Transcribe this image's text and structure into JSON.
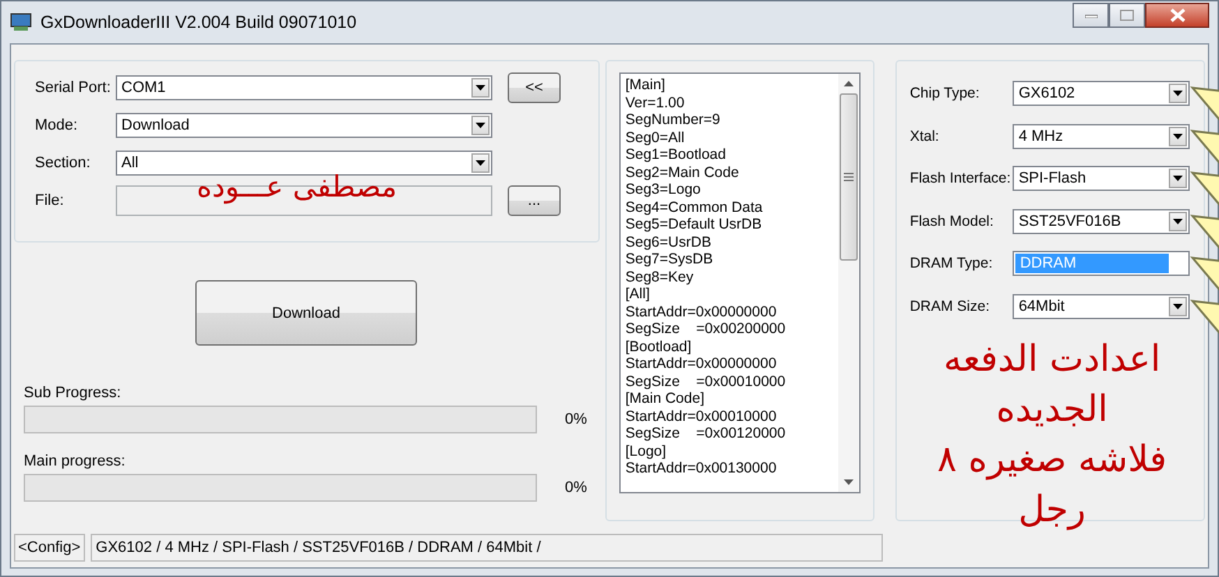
{
  "window": {
    "title": "GxDownloaderIII V2.004 Build 09071010"
  },
  "port_settings": {
    "fields": [
      {
        "kind": "combo",
        "label": "Serial Port:",
        "value": "COM1",
        "button": "<<"
      },
      {
        "kind": "combo",
        "label": "Mode:",
        "value": "Download"
      },
      {
        "kind": "combo",
        "label": "Section:",
        "value": "All"
      },
      {
        "kind": "file",
        "label": "File:",
        "disabled": true,
        "button": "..."
      }
    ]
  },
  "download_button": "Download",
  "progress": [
    {
      "label": "Sub Progress:",
      "level": 0,
      "reading": "0%"
    },
    {
      "label": "Main progress:",
      "level": 0,
      "reading": "0%"
    }
  ],
  "config_list": [
    "[Main]",
    "Ver=1.00",
    "SegNumber=9",
    "Seg0=All",
    "Seg1=Bootload",
    "Seg2=Main Code",
    "Seg3=Logo",
    "Seg4=Common Data",
    "Seg5=Default UsrDB",
    "Seg6=UsrDB",
    "Seg7=SysDB",
    "Seg8=Key",
    "[All]",
    "StartAddr=0x00000000",
    "SegSize    =0x00200000",
    "[Bootload]",
    "StartAddr=0x00000000",
    "SegSize    =0x00010000",
    "[Main Code]",
    "StartAddr=0x00010000",
    "SegSize    =0x00120000",
    "[Logo]",
    "StartAddr=0x00130000"
  ],
  "chip_settings": {
    "fields": [
      {
        "label": "Chip Type:",
        "value": "GX6102",
        "selected": false,
        "arrow": true
      },
      {
        "label": "Xtal:",
        "value": "4 MHz",
        "selected": false,
        "arrow": true
      },
      {
        "label": "Flash Interface:",
        "value": "SPI-Flash",
        "selected": false,
        "arrow": true
      },
      {
        "label": "Flash Model:",
        "value": "SST25VF016B",
        "selected": false,
        "arrow": true
      },
      {
        "label": "DRAM Type:",
        "value": "DDRAM",
        "selected": true,
        "arrow": true
      },
      {
        "label": "DRAM Size:",
        "value": "64Mbit",
        "selected": false,
        "arrow": true
      }
    ]
  },
  "annotations": {
    "name": "مصطفى عـــوده",
    "note": [
      "اعدادت الدفعه",
      "الجديده",
      "فلاشه صغيره ٨",
      "رجل"
    ]
  },
  "status_bar": {
    "config_button": "<Config>",
    "summary": "GX6102 / 4 MHz / SPI-Flash / SST25VF016B / DDRAM / 64Mbit /"
  }
}
